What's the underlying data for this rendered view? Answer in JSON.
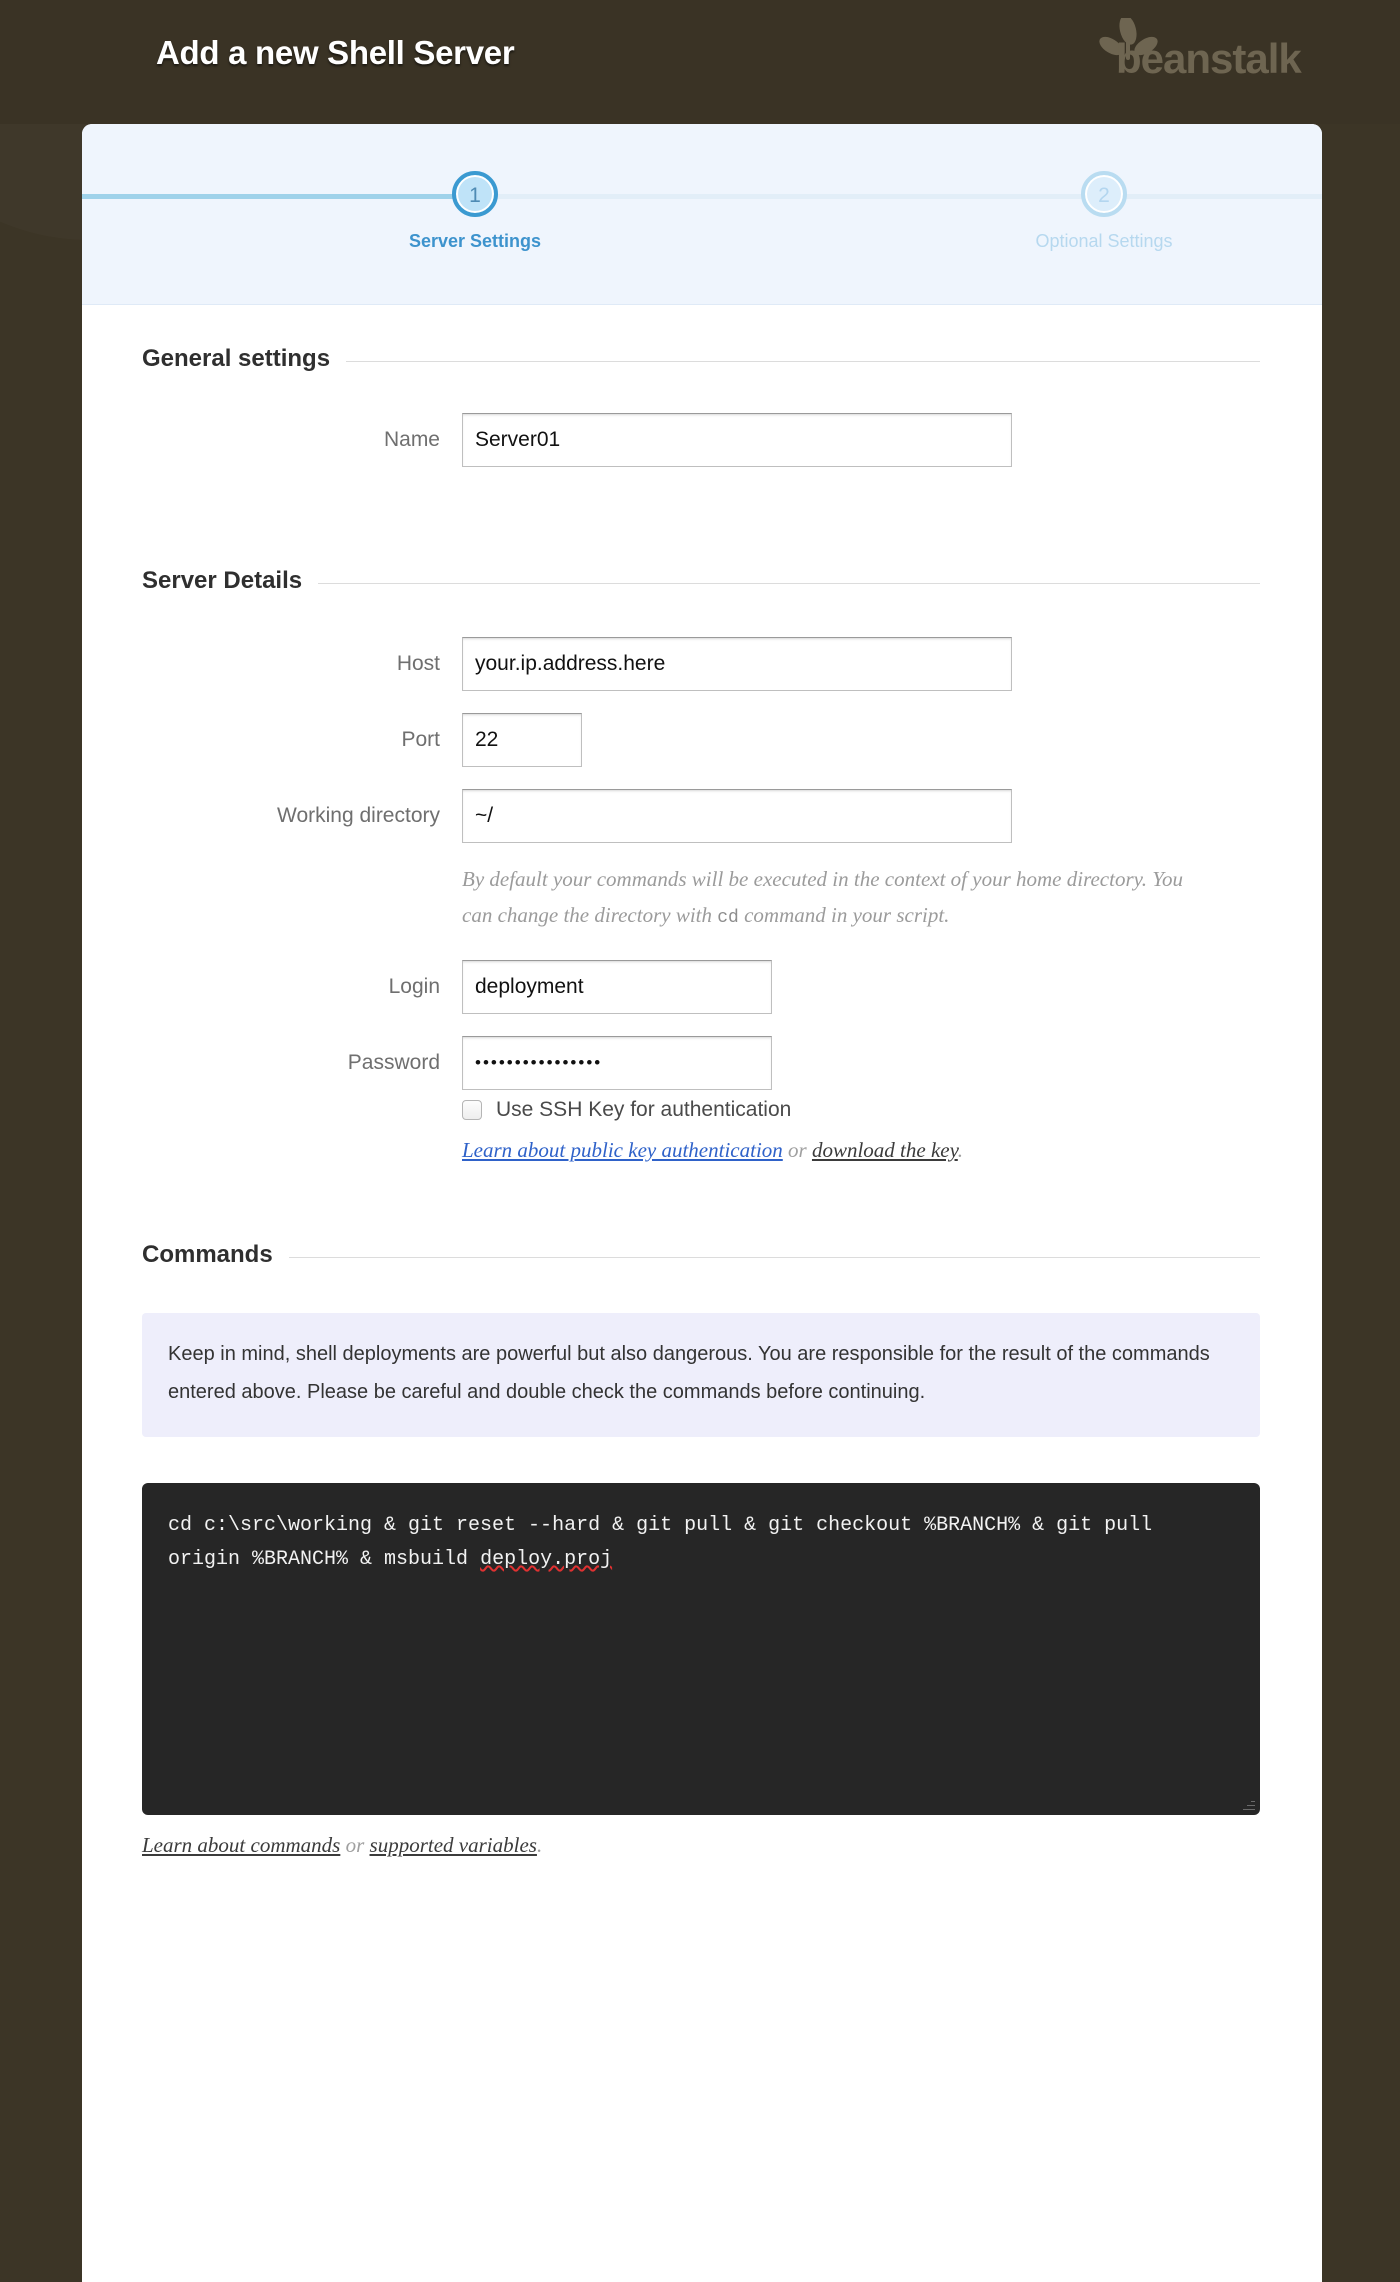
{
  "header": {
    "title": "Add a new Shell Server",
    "brand": "beanstalk",
    "logo_icon": "beanstalk-leaf-logo"
  },
  "stepper": {
    "steps": [
      {
        "number": "1",
        "label": "Server Settings",
        "state": "active"
      },
      {
        "number": "2",
        "label": "Optional Settings",
        "state": "pending"
      }
    ]
  },
  "sections": {
    "general": {
      "title": "General settings",
      "name_label": "Name",
      "name_value": "Server01"
    },
    "server_details": {
      "title": "Server Details",
      "host_label": "Host",
      "host_value": "your.ip.address.here",
      "port_label": "Port",
      "port_value": "22",
      "workdir_label": "Working directory",
      "workdir_value": "~/",
      "workdir_help_1": "By default your commands will be executed in the context of your home directory. You can change the directory with ",
      "workdir_help_code": "cd",
      "workdir_help_2": " command in your script.",
      "login_label": "Login",
      "login_value": "deployment",
      "password_label": "Password",
      "password_value": "••••••••••••••••",
      "ssh_checkbox_label": "Use SSH Key for authentication",
      "ssh_checkbox_checked": false,
      "link_learn_pubkey": "Learn about public key authentication",
      "link_or": "or",
      "link_download_key": "download the key",
      "link_period": "."
    },
    "commands": {
      "title": "Commands",
      "notice": "Keep in mind, shell deployments are powerful but also dangerous. You are responsible for the result of the commands entered above. Please be careful and double check the commands before continuing.",
      "script_part1": "cd c:\\src\\working & git reset --hard & git pull & git checkout %BRANCH% & git pull origin %BRANCH% & msbuild ",
      "script_misspelled": "deploy.proj",
      "link_learn_commands": "Learn about commands",
      "link_or": "or",
      "link_supported_variables": "supported variables",
      "link_period": "."
    }
  },
  "colors": {
    "page_background": "#3c3526",
    "card_background": "#ffffff",
    "stepper_background": "#eff5fd",
    "accent_blue": "#3d93cd",
    "step_done_line": "#9fd2ea",
    "step_todo_line": "#e2eef8",
    "notice_background": "#eeeefb",
    "code_background": "#262626",
    "link_blue": "#2f62c9",
    "spellcheck_red": "#e03131"
  }
}
